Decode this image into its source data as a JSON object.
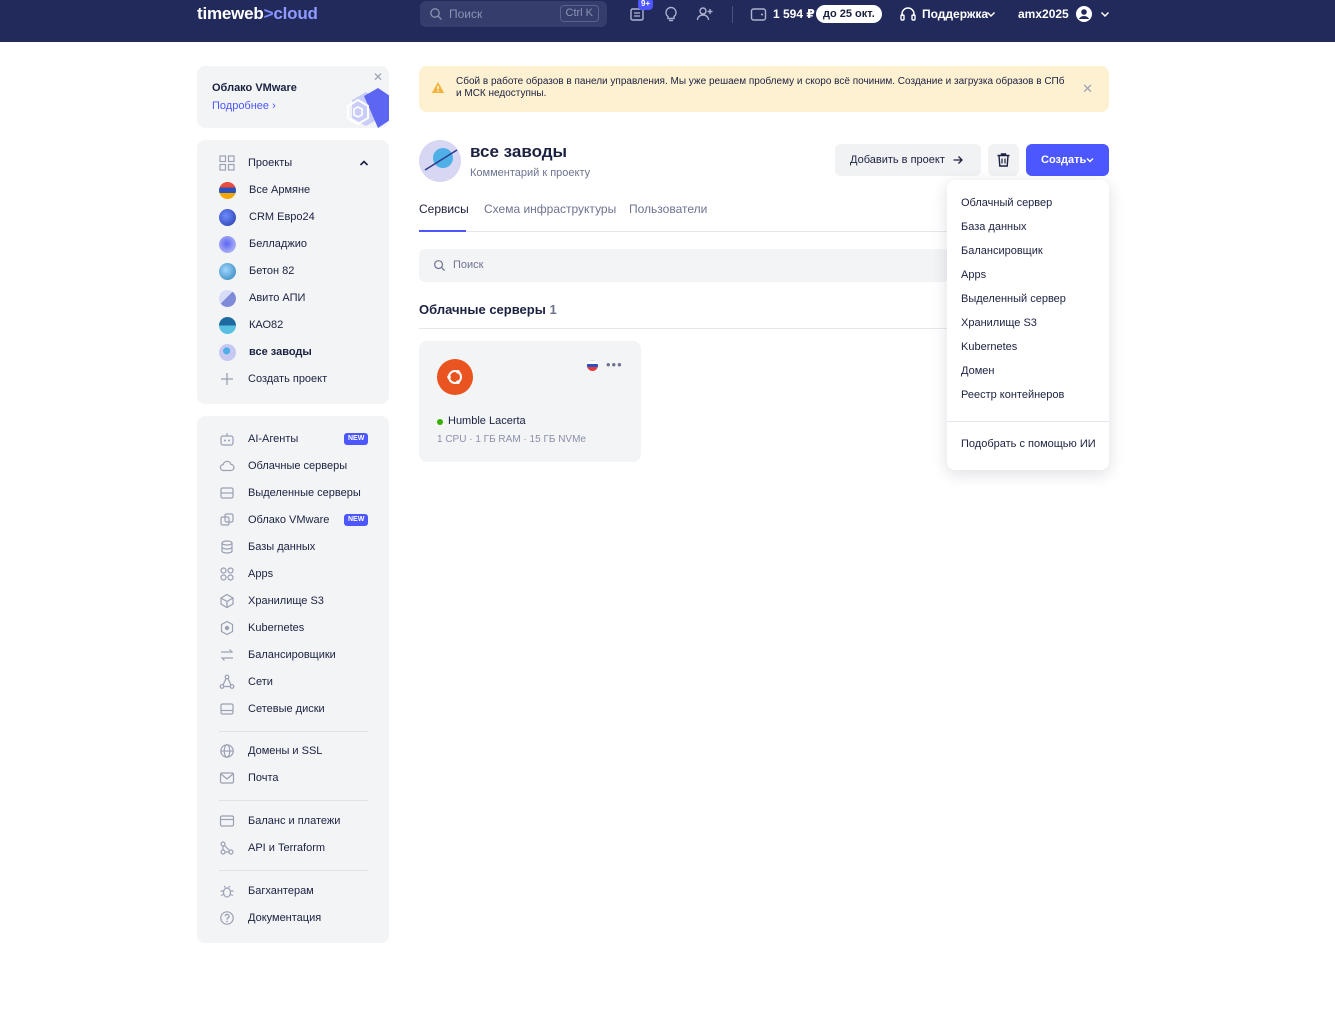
{
  "header": {
    "logo_main": "timeweb",
    "logo_arrow": ">",
    "logo_cloud": "cloud",
    "search_placeholder": "Поиск",
    "search_shortcut": "Ctrl K",
    "notifications_badge": "9+",
    "balance": "1 594 ₽",
    "due": "до 25 окт.",
    "support": "Поддержка",
    "username": "amx2025"
  },
  "promo": {
    "title": "Облако VMware",
    "link": "Подробнее"
  },
  "projects": {
    "title": "Проекты",
    "items": [
      {
        "label": "Все Армяне",
        "color": "#e94b3c"
      },
      {
        "label": "CRM Евро24",
        "color": "#3b52c4"
      },
      {
        "label": "Белладжио",
        "color": "#7a8cf0"
      },
      {
        "label": "Бетон 82",
        "color": "#4fa3d8"
      },
      {
        "label": "Авито АПИ",
        "color": "#8f9ad8"
      },
      {
        "label": "КАО82",
        "color": "#2b7fb5"
      },
      {
        "label": "все заводы",
        "color": "#b7b9ef"
      }
    ],
    "create_label": "Создать проект"
  },
  "nav": {
    "items": [
      {
        "label": "AI-Агенты",
        "badge": "NEW",
        "icon": "robot-icon"
      },
      {
        "label": "Облачные серверы",
        "icon": "cloud-icon"
      },
      {
        "label": "Выделенные серверы",
        "icon": "server-icon"
      },
      {
        "label": "Облако VMware",
        "badge": "NEW",
        "icon": "vmware-icon"
      },
      {
        "label": "Базы данных",
        "icon": "database-icon"
      },
      {
        "label": "Apps",
        "icon": "apps-icon"
      },
      {
        "label": "Хранилище S3",
        "icon": "cube-icon"
      },
      {
        "label": "Kubernetes",
        "icon": "kubernetes-icon"
      },
      {
        "label": "Балансировщики",
        "icon": "balancer-icon"
      },
      {
        "label": "Сети",
        "icon": "network-icon"
      },
      {
        "label": "Сетевые диски",
        "icon": "disk-icon"
      },
      {
        "label": "Домены и SSL",
        "icon": "globe-icon"
      },
      {
        "label": "Почта",
        "icon": "mail-icon"
      },
      {
        "label": "Баланс и платежи",
        "icon": "card-icon"
      },
      {
        "label": "API и Terraform",
        "icon": "api-icon"
      },
      {
        "label": "Багхантерам",
        "icon": "bug-icon"
      },
      {
        "label": "Документация",
        "icon": "help-icon"
      }
    ]
  },
  "alert": {
    "text": "Сбой в работе образов в панели управления. Мы уже решаем проблему и скоро всё починим. Создание и загрузка образов в СПб и МСК недоступны."
  },
  "project": {
    "name": "все заводы",
    "comment": "Комментарий к проекту",
    "add_button": "Добавить в проект",
    "create_button": "Создать"
  },
  "tabs": [
    "Сервисы",
    "Схема инфраструктуры",
    "Пользователи"
  ],
  "main_search_placeholder": "Поиск",
  "section": {
    "title": "Облачные серверы",
    "count": "1"
  },
  "server": {
    "name": "Humble Lacerta",
    "spec": "1 CPU · 1 ГБ RAM · 15 ГБ NVMe",
    "status": "running"
  },
  "create_menu": {
    "items": [
      "Облачный сервер",
      "База данных",
      "Балансировщик",
      "Apps",
      "Выделенный сервер",
      "Хранилище S3",
      "Kubernetes",
      "Домен",
      "Реестр контейнеров"
    ],
    "ai_item": "Подобрать с помощью ИИ"
  },
  "colors": {
    "brand": "#4c57ff",
    "topbar": "#222a5c",
    "alert_bg": "#fdf1d2",
    "panel_bg": "#f3f4f6"
  }
}
